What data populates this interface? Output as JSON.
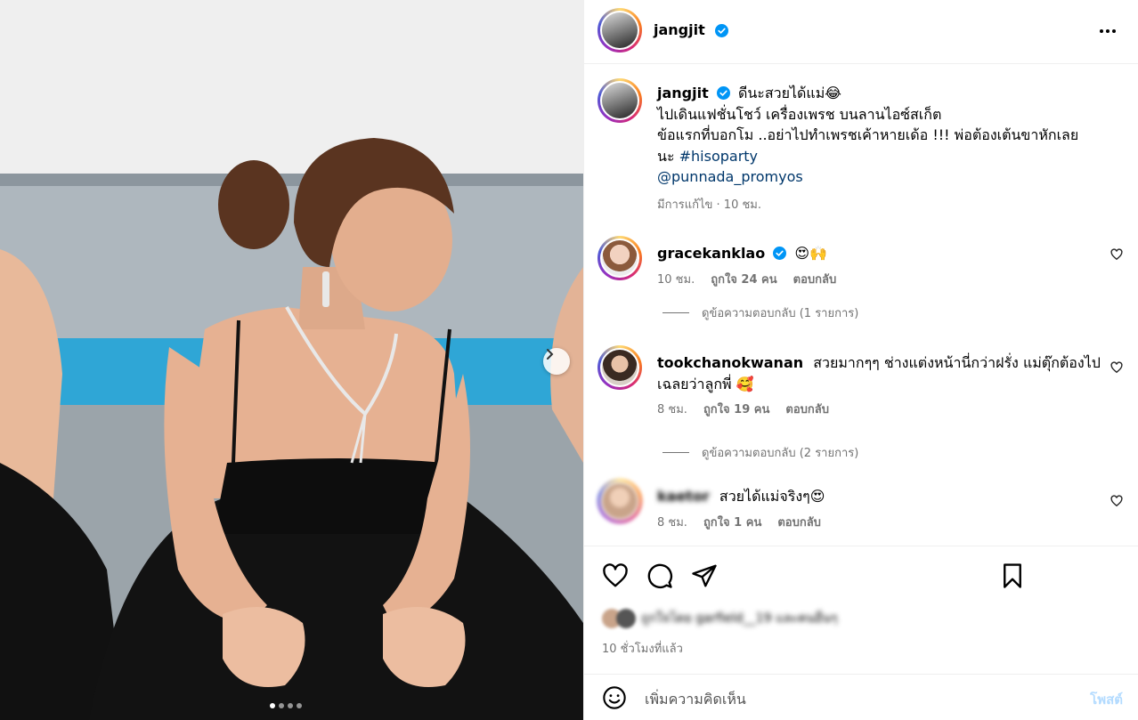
{
  "post": {
    "author": "jangjit",
    "author_verified": true,
    "photo": {
      "carousel_dots": 4,
      "active_dot": 0,
      "next_icon": "chevron-right-icon"
    }
  },
  "caption": {
    "username": "jangjit",
    "text_line1": "ดีนะสวยได้แม่😂",
    "text_line2": "ไปเดินแฟชั่นโชว์ เครื่องเพรช บนลานไอซ์สเก็ต",
    "text_line3": "ข้อแรกที่บอกโม ..อย่าไปทำเพรชเค้าหายเด้อ !!! พ่อต้องเต้นขาหักเลย",
    "text_line4_prefix": "นะ",
    "hashtag": "#hisoparty",
    "mention": "@punnada_promyos",
    "meta": "มีการแก้ไข · 10 ชม."
  },
  "comments": [
    {
      "username": "gracekanklao",
      "verified": true,
      "text": "😍🙌",
      "time": "10 ชม.",
      "likes": "ถูกใจ 24 คน",
      "reply": "ตอบกลับ",
      "replies_label": "ดูข้อความตอบกลับ (1 รายการ)"
    },
    {
      "username": "tookchanokwanan",
      "verified": false,
      "text": "สวยมากๆๆ ช่างแต่งหน้านี่กว่าฝรั่ง แม่ตุ๊กต้องไปเฉลยว่าลูกพี่ 🥰",
      "time": "8 ชม.",
      "likes": "ถูกใจ 19 คน",
      "reply": "ตอบกลับ",
      "replies_label": "ดูข้อความตอบกลับ (2 รายการ)"
    },
    {
      "username": "kaetor",
      "verified": false,
      "text": "สวยได้แม่จริงๆ😍",
      "time": "8 ชม.",
      "likes": "ถูกใจ 1 คน",
      "reply": "ตอบกลับ"
    }
  ],
  "actions": {
    "icons": [
      "heart-icon",
      "comment-icon",
      "share-icon",
      "bookmark-icon"
    ],
    "liked_by": "ถูกใจโดย garfield__19 และคนอื่นๆ",
    "time_ago": "10 ชั่วโมงที่แล้ว"
  },
  "add_comment": {
    "placeholder": "เพิ่มความคิดเห็น",
    "post_label": "โพสต์"
  },
  "colors": {
    "link": "#00376b",
    "muted": "#737373",
    "post_disabled": "#b3dbff",
    "verified": "#0095f6",
    "divider": "#efefef"
  }
}
